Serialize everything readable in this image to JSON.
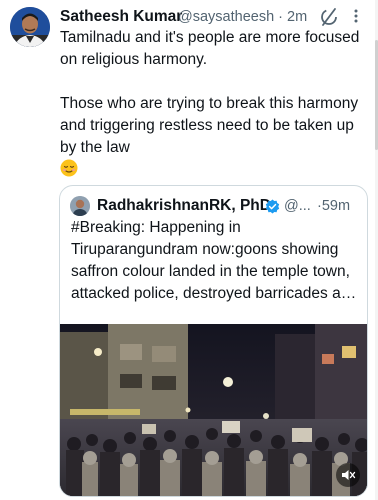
{
  "tweet": {
    "author_name": "Satheesh Kumar",
    "handle": "@saysatheesh",
    "separator": "·",
    "time": "2m",
    "text": "Tamilnadu and it's people are more focused on religious harmony.\n\nThose who are trying to break this harmony and triggering restless need to be taken up by the law",
    "emoji": "relieved-face"
  },
  "quote": {
    "author_name": "RadhakrishnanRK, PhD.",
    "handle": "@...",
    "time": "·59m",
    "verified_color": "#1d9bf0",
    "text": "#Breaking: Happening in Tiruparangundram now:goons showing saffron colour landed in the temple town, attacked police, destroyed barricades and a group is now running up the hill. The Ma...",
    "media": {
      "type": "video",
      "muted": true
    }
  },
  "colors": {
    "text": "#0f1419",
    "secondary": "#536471",
    "border": "#cfd9de",
    "verified": "#1d9bf0"
  },
  "icons": {
    "grok": "grok-icon",
    "more": "more-vertical-icon",
    "mute": "speaker-muted-icon"
  }
}
